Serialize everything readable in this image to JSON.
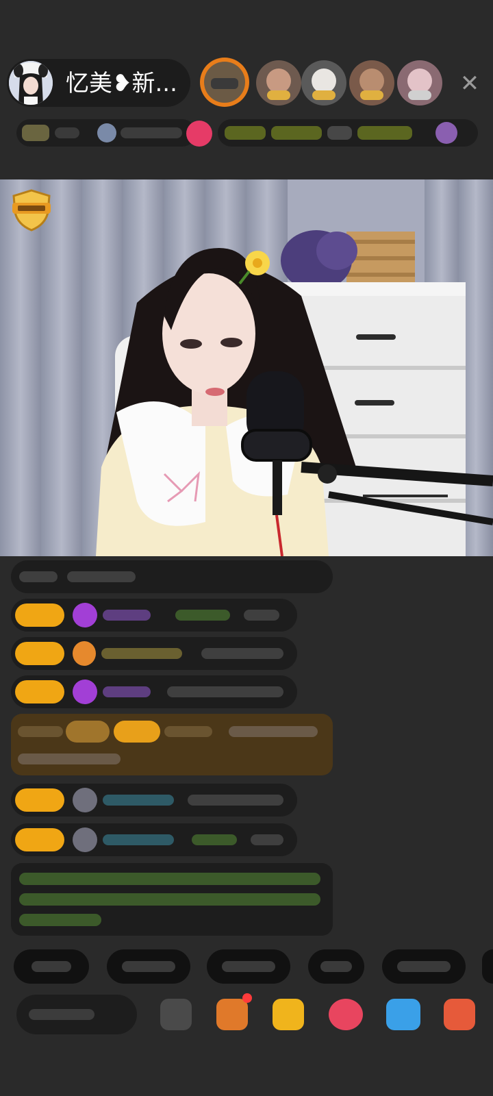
{
  "header": {
    "host_name": "忆美❥新..."
  },
  "icons": {
    "close": "close-icon",
    "shield": "shield-badge-icon",
    "red_dot": "notification-dot"
  }
}
